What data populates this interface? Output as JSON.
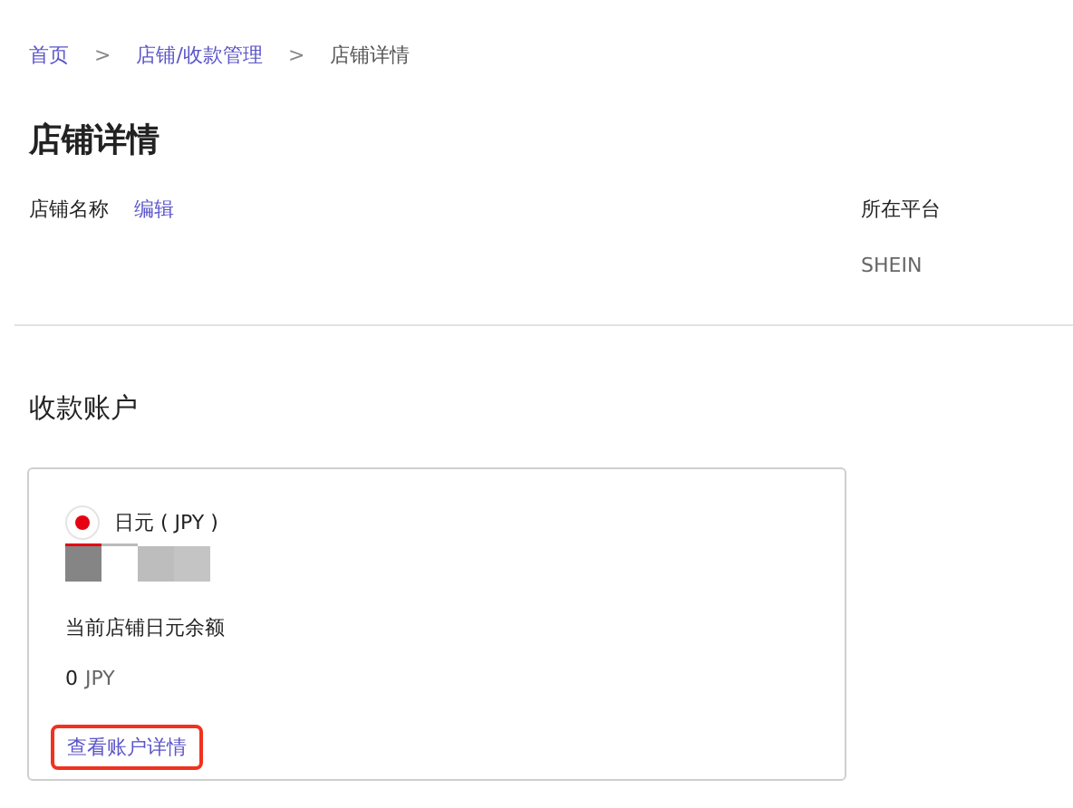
{
  "breadcrumb": [
    {
      "label": "首页",
      "current": false
    },
    {
      "label": "店铺/收款管理",
      "current": false
    },
    {
      "label": "店铺详情",
      "current": true
    }
  ],
  "breadcrumb_separator": ">",
  "page_title": "店铺详情",
  "store_name": {
    "label": "店铺名称",
    "edit_link": "编辑"
  },
  "platform": {
    "label": "所在平台",
    "value": "SHEIN"
  },
  "section_title": "收款账户",
  "account_card": {
    "currency": "日元 ( JPY )",
    "balance_label": "当前店铺日元余额",
    "balance_amount": "0",
    "balance_unit": "JPY",
    "details_link": "查看账户详情",
    "details_link_highlighted": true
  }
}
